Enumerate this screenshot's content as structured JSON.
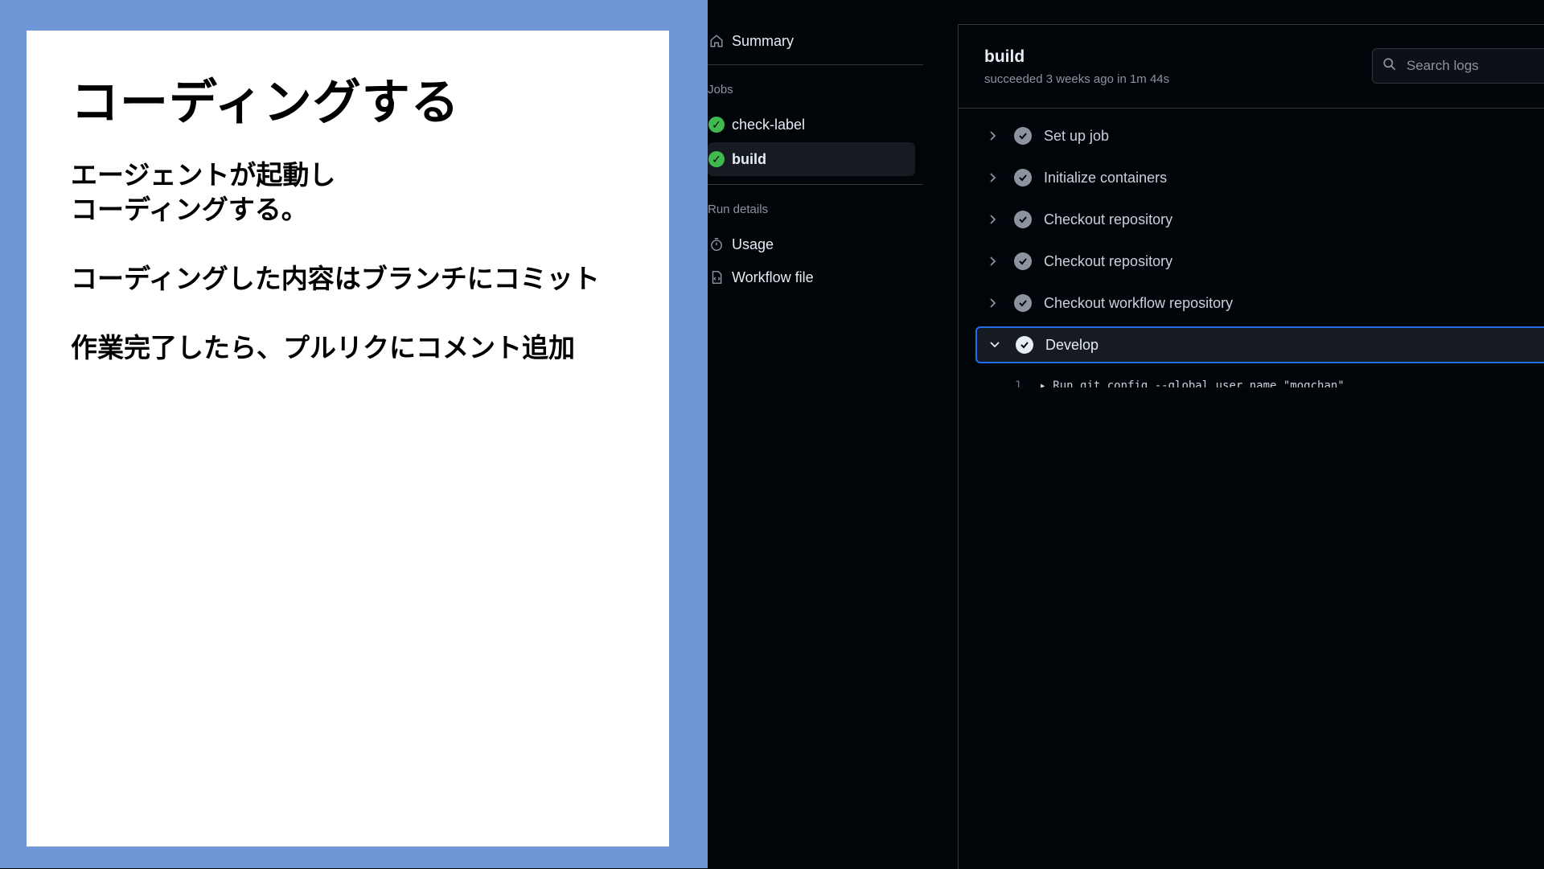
{
  "slide": {
    "title": "コーディングする",
    "paragraphs": [
      "エージェントが起動し\nコーディングする。",
      "コーディングした内容はブランチにコミット",
      "作業完了したら、プルリクにコメント追加"
    ]
  },
  "sidebar": {
    "summary_label": "Summary",
    "jobs_heading": "Jobs",
    "jobs": [
      {
        "label": "check-label",
        "status": "success"
      },
      {
        "label": "build",
        "status": "success",
        "active": true
      }
    ],
    "run_details_heading": "Run details",
    "details": [
      {
        "label": "Usage",
        "icon": "stopwatch-icon"
      },
      {
        "label": "Workflow file",
        "icon": "file-code-icon"
      }
    ]
  },
  "job": {
    "title": "build",
    "subtitle": "succeeded 3 weeks ago in 1m 44s",
    "search_placeholder": "Search logs",
    "steps": [
      {
        "label": "Set up job",
        "expanded": false
      },
      {
        "label": "Initialize containers",
        "expanded": false
      },
      {
        "label": "Checkout repository",
        "expanded": false
      },
      {
        "label": "Checkout repository",
        "expanded": false
      },
      {
        "label": "Checkout workflow repository",
        "expanded": false
      },
      {
        "label": "Develop",
        "expanded": true
      }
    ],
    "log_line_number": "1",
    "log_line_text": "▸ Run git config --global user.name \"mogchan\""
  },
  "colors": {
    "slide_bg": "#6f96d6",
    "success_green": "#3fb950",
    "focus_blue": "#1f6feb"
  }
}
